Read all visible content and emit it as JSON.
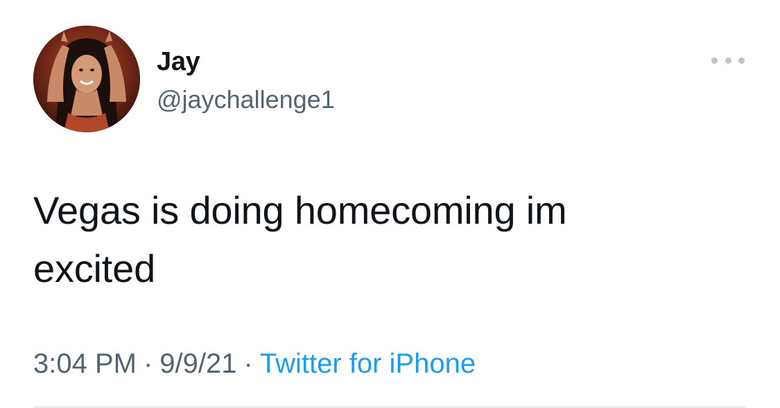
{
  "author": {
    "display_name": "Jay",
    "handle": "@jaychallenge1",
    "avatar_icon": "profile-photo"
  },
  "tweet": {
    "text_line_1": "Vegas is doing homecoming im",
    "text_line_2": "excited"
  },
  "meta": {
    "time": "3:04 PM",
    "separator": "·",
    "date": "9/9/21",
    "source": "Twitter for iPhone"
  },
  "icons": {
    "more": "more-options-icon"
  },
  "colors": {
    "text_primary": "#0f1419",
    "text_secondary": "#536471",
    "link": "#1d9bf0",
    "divider": "#cfd9de"
  }
}
